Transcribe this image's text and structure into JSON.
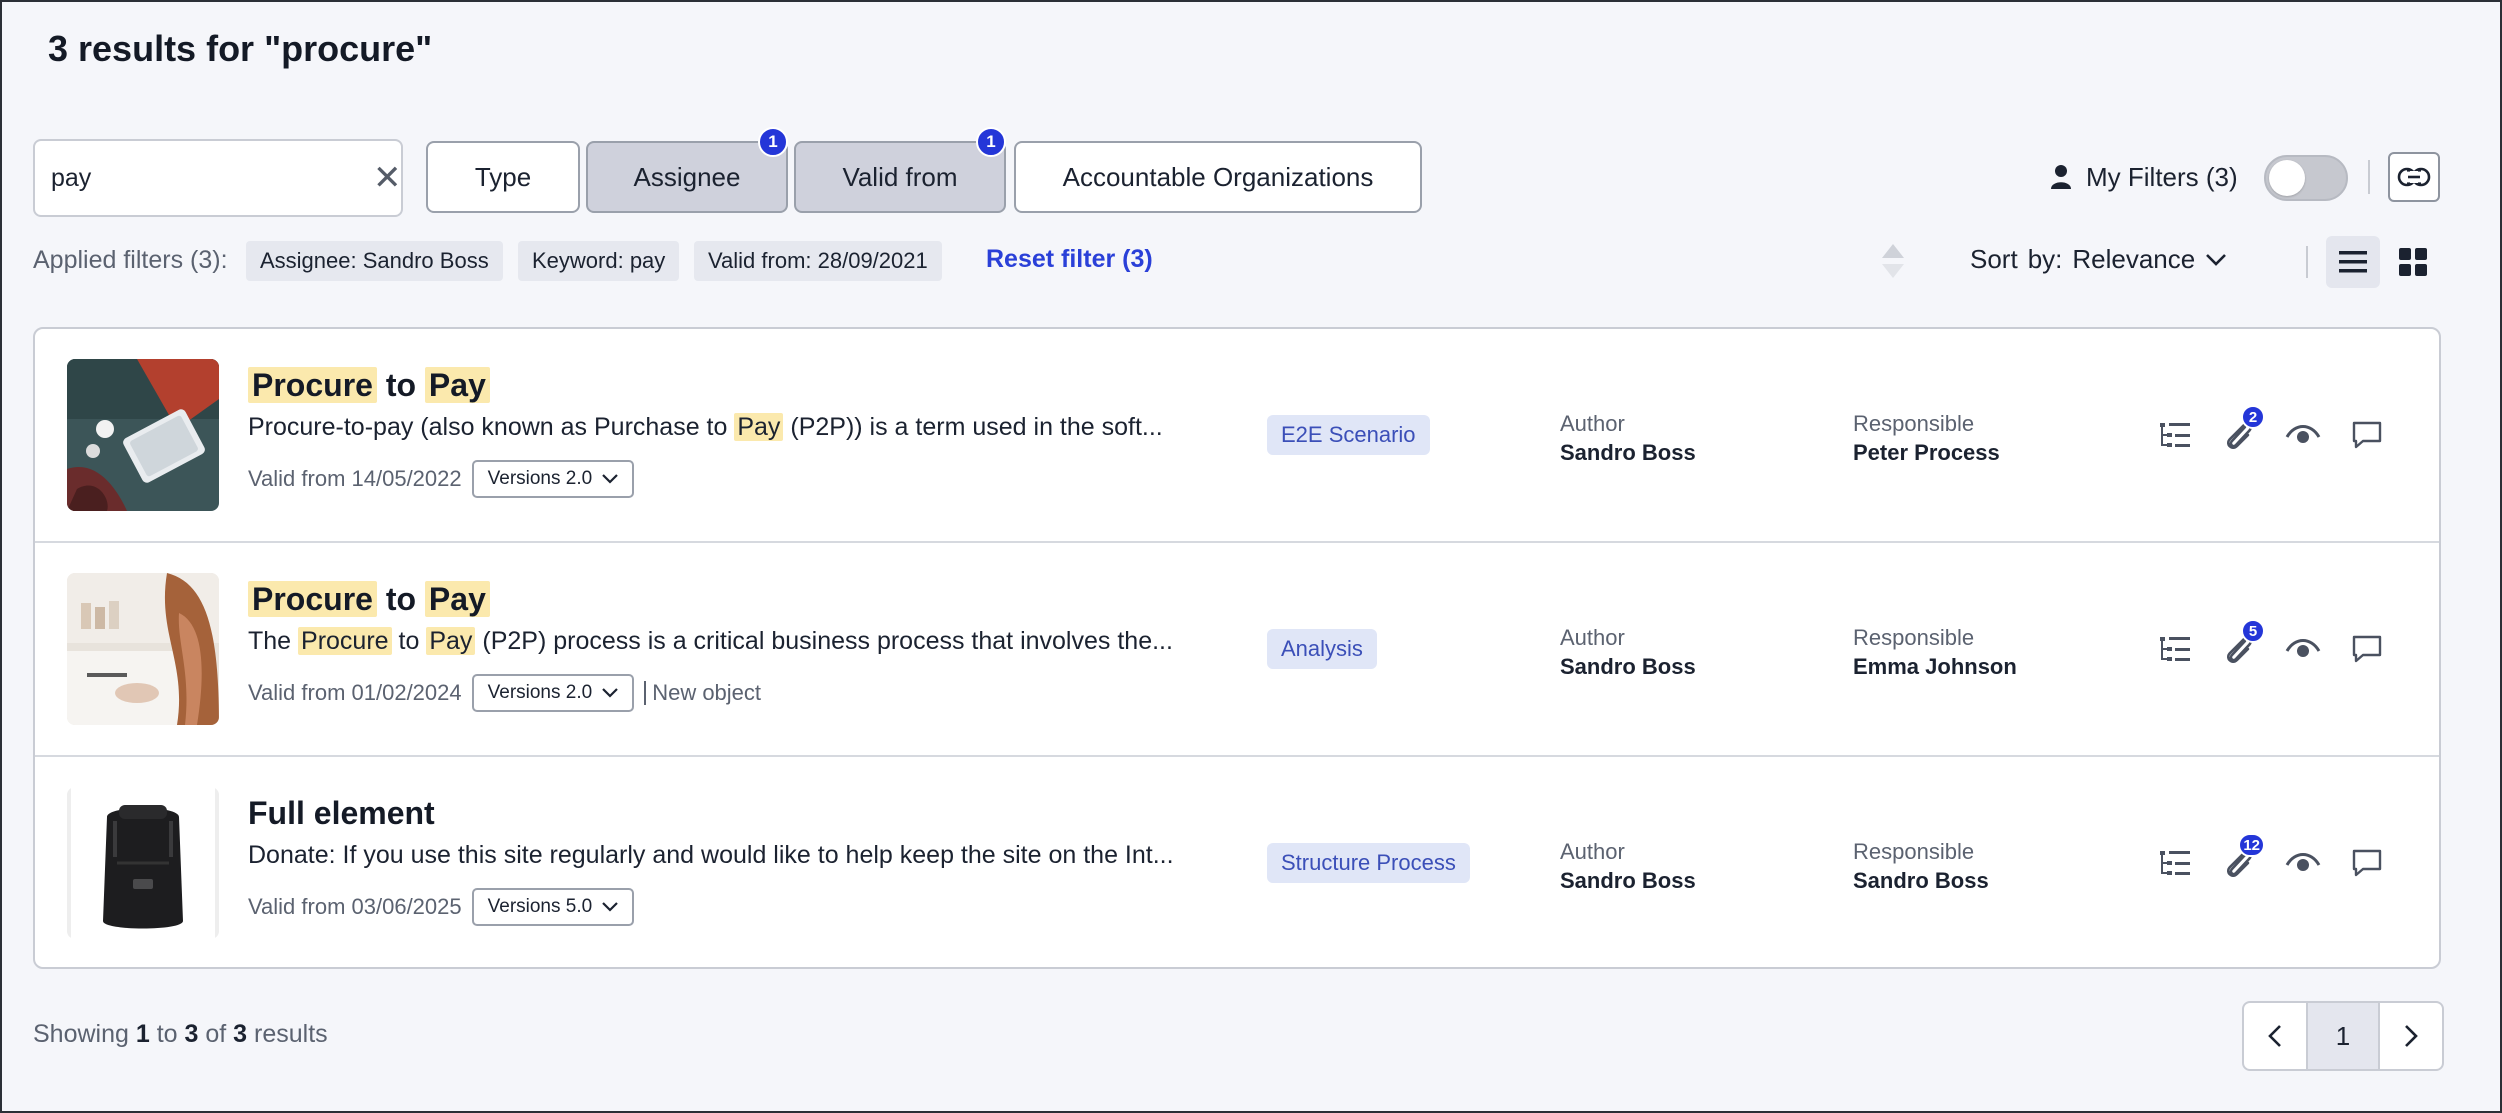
{
  "page": {
    "title": "3 results for \"procure\""
  },
  "search": {
    "value": "pay",
    "clear_icon": "close-icon"
  },
  "filters": [
    {
      "label": "Type",
      "active": false,
      "badge": ""
    },
    {
      "label": "Assignee",
      "active": true,
      "badge": "1"
    },
    {
      "label": "Valid from",
      "active": true,
      "badge": "1"
    },
    {
      "label": "Accountable Organizations",
      "active": false,
      "badge": ""
    }
  ],
  "my_filters": {
    "label": "My Filters (3)",
    "icon": "user-icon",
    "enabled": false
  },
  "applied": {
    "label": "Applied filters (3):",
    "chips": [
      "Assignee: Sandro Boss",
      "Keyword: pay",
      "Valid from: 28/09/2021"
    ],
    "reset": "Reset filter (3)"
  },
  "sort": {
    "label": "Sort",
    "by": "by:",
    "value": "Relevance"
  },
  "results": [
    {
      "title_parts": [
        "Procure",
        " to ",
        "Pay"
      ],
      "desc_parts": [
        "Procure-to-pay (also known as Purchase to ",
        "Pay",
        " (P2P)) is a term used in the soft..."
      ],
      "valid_from": "Valid from 14/05/2022",
      "versions": "Versions 2.0",
      "extra": "",
      "tag": "E2E Scenario",
      "author_label": "Author",
      "author": "Sandro Boss",
      "responsible_label": "Responsible",
      "responsible": "Peter Process",
      "attachments": "2"
    },
    {
      "title_parts": [
        "Procure",
        " to ",
        "Pay"
      ],
      "desc_parts": [
        "The ",
        "Procure",
        " to ",
        "Pay",
        " (P2P) process is a critical business process that involves the..."
      ],
      "valid_from": "Valid from 01/02/2024",
      "versions": "Versions 2.0",
      "extra": "New object",
      "tag": "Analysis",
      "author_label": "Author",
      "author": "Sandro Boss",
      "responsible_label": "Responsible",
      "responsible": "Emma Johnson",
      "attachments": "5"
    },
    {
      "title_parts": [
        "Full element"
      ],
      "desc_parts": [
        "Donate: If you use this site regularly and would like to help keep the site on the Int..."
      ],
      "valid_from": "Valid from 03/06/2025",
      "versions": "Versions 5.0",
      "extra": "",
      "tag": "Structure Process",
      "author_label": "Author",
      "author": "Sandro Boss",
      "responsible_label": "Responsible",
      "responsible": "Sandro Boss",
      "attachments": "12"
    }
  ],
  "footer": {
    "showing_prefix": "Showing ",
    "from": "1",
    "to_word": " to ",
    "to": "3",
    "of_word": " of ",
    "total": "3",
    "suffix": " results",
    "current_page": "1"
  },
  "colors": {
    "accent": "#2436d8",
    "highlight": "#fbe9ad",
    "tag_bg": "#e0e6f7"
  }
}
